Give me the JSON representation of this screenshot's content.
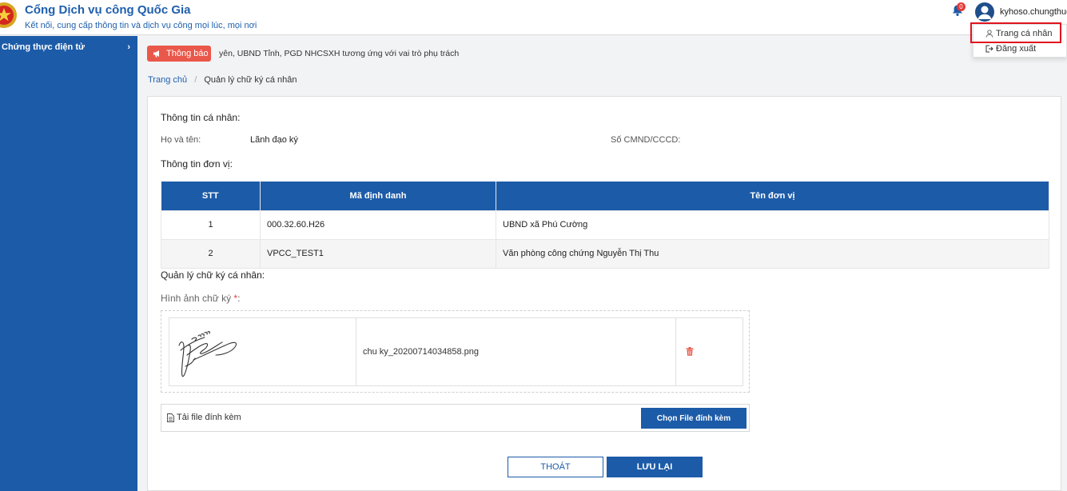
{
  "header": {
    "title": "Cổng Dịch vụ công Quốc Gia",
    "subtitle": "Kết nối, cung cấp thông tin và dịch vụ công mọi lúc, mọi nơi",
    "notification_count": "0",
    "username": "kyhoso.chungthuc",
    "logo_icon": "national-emblem-icon",
    "bell_icon": "bell-icon",
    "avatar_icon": "user-avatar-icon"
  },
  "user_menu": {
    "profile_label": "Trang cá nhân",
    "logout_label": "Đăng xuất",
    "highlight_color": "#e0141e"
  },
  "sidebar": {
    "items": [
      {
        "label": "Chứng thực điện tử",
        "icon": "chevron-right-icon"
      }
    ]
  },
  "notice": {
    "button_label": "Thông báo",
    "text": "yên, UBND Tỉnh, PGD NHCSXH tương ứng với vai trò phụ trách"
  },
  "breadcrumb": {
    "home": "Trang chủ",
    "separator": "/",
    "current": "Quản lý chữ ký cá nhân"
  },
  "personal": {
    "section_title": "Thông tin cá nhân:",
    "name_label": "Họ và tên:",
    "name_value": "Lãnh đạo ký",
    "id_label": "Số CMND/CCCD:",
    "id_value": ""
  },
  "units": {
    "section_title": "Thông tin đơn vị:",
    "columns": [
      "STT",
      "Mã định danh",
      "Tên đơn vị"
    ],
    "rows": [
      {
        "stt": "1",
        "code": "000.32.60.H26",
        "name": "UBND xã Phú Cường"
      },
      {
        "stt": "2",
        "code": "VPCC_TEST1",
        "name": "Văn phòng công chứng Nguyễn Thị Thu"
      }
    ]
  },
  "signature": {
    "section_title": "Quản lý chữ ký cá nhân:",
    "image_label": "Hình ảnh chữ ký",
    "required_mark": "*",
    "label_suffix": ":",
    "filename": "chu ky_20200714034858.png",
    "delete_icon": "trash-icon",
    "attach_label": "Tải file đính kèm",
    "attach_icon": "file-icon",
    "choose_button": "Chọn File đính kèm"
  },
  "actions": {
    "exit_label": "THOÁT",
    "save_label": "LƯU LẠI"
  },
  "colors": {
    "primary": "#1c5ba8",
    "notice": "#e9584a",
    "danger": "#e53935"
  }
}
